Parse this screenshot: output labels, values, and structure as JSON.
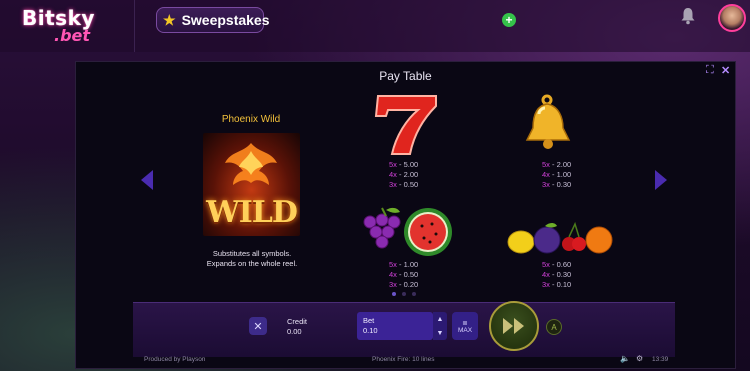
{
  "header": {
    "logo_text": "Bitsky",
    "logo_sub": ".bet",
    "sweepstakes_label": "Sweepstakes",
    "plus_glyph": "+"
  },
  "icons": {
    "star": "star-icon",
    "bell": "bell-icon",
    "fullscreen": "fullscreen-icon",
    "close": "close-icon",
    "settings": "gear-icon",
    "sound": "speaker-icon"
  },
  "paytable": {
    "title": "Pay Table",
    "wild_title": "Phoenix Wild",
    "wild_image_text": "WILD",
    "wild_desc_line1": "Substitutes all symbols.",
    "wild_desc_line2": "Expands on the whole reel.",
    "symbols": [
      {
        "name": "seven",
        "odds": [
          [
            "5x",
            "5.00"
          ],
          [
            "4x",
            "2.00"
          ],
          [
            "3x",
            "0.50"
          ]
        ]
      },
      {
        "name": "bell",
        "odds": [
          [
            "5x",
            "2.00"
          ],
          [
            "4x",
            "1.00"
          ],
          [
            "3x",
            "0.30"
          ]
        ]
      },
      {
        "name": "grapes-watermelon",
        "odds": [
          [
            "5x",
            "1.00"
          ],
          [
            "4x",
            "0.50"
          ],
          [
            "3x",
            "0.20"
          ]
        ]
      },
      {
        "name": "fruits",
        "odds": [
          [
            "5x",
            "0.60"
          ],
          [
            "4x",
            "0.30"
          ],
          [
            "3x",
            "0.10"
          ]
        ]
      }
    ],
    "page_count": 3,
    "current_page": 1
  },
  "controls": {
    "close_glyph": "✕",
    "credit_label": "Credit",
    "credit_value": "0.00",
    "bet_label": "Bet",
    "bet_value": "0.10",
    "max_label": "MAX",
    "auto_glyph": "A"
  },
  "footer": {
    "produced_by": "Produced by Playson",
    "game_info": "Phoenix Fire: 10 lines",
    "time": "13:39"
  },
  "colors": {
    "accent_purple": "#3b2396",
    "multiplier_pink": "#d040d8",
    "gold": "#f2c03a"
  }
}
